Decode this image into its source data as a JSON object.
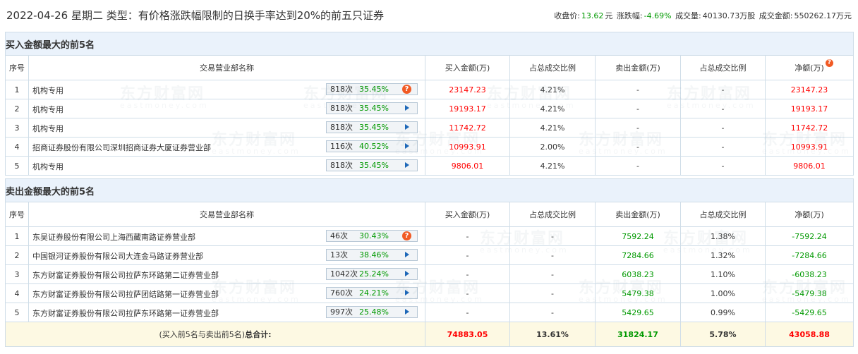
{
  "header": {
    "title": "2022-04-26 星期二 类型：有价格涨跌幅限制的日换手率达到20%的前五只证券",
    "close_label": "收盘价:",
    "close_value": "13.62",
    "close_unit": "元",
    "change_label": "涨跌幅:",
    "change_value": "-4.69%",
    "volume_label": "成交量:",
    "volume_value": "40130.73万股",
    "amount_label": "成交金额:",
    "amount_value": "550262.17万元"
  },
  "columns": {
    "index": "序号",
    "dept": "交易营业部名称",
    "buy": "买入金额(万)",
    "buy_pct": "占总成交比例",
    "sell": "卖出金额(万)",
    "sell_pct": "占总成交比例",
    "net": "净额(万)"
  },
  "buy_section": {
    "title": "买入金额最大的前5名",
    "rows": [
      {
        "idx": "1",
        "name": "机构专用",
        "times": "818次",
        "rate": "35.45%",
        "icon": "question-icon",
        "buy": "23147.23",
        "buy_pct": "4.21%",
        "sell": "-",
        "sell_pct": "-",
        "net": "23147.23"
      },
      {
        "idx": "2",
        "name": "机构专用",
        "times": "818次",
        "rate": "35.45%",
        "icon": "play-icon",
        "buy": "19193.17",
        "buy_pct": "4.21%",
        "sell": "-",
        "sell_pct": "-",
        "net": "19193.17"
      },
      {
        "idx": "3",
        "name": "机构专用",
        "times": "818次",
        "rate": "35.45%",
        "icon": "play-icon",
        "buy": "11742.72",
        "buy_pct": "4.21%",
        "sell": "-",
        "sell_pct": "-",
        "net": "11742.72"
      },
      {
        "idx": "4",
        "name": "招商证券股份有限公司深圳招商证券大厦证券营业部",
        "times": "116次",
        "rate": "40.52%",
        "icon": "play-icon",
        "buy": "10993.91",
        "buy_pct": "2.00%",
        "sell": "-",
        "sell_pct": "-",
        "net": "10993.91"
      },
      {
        "idx": "5",
        "name": "机构专用",
        "times": "818次",
        "rate": "35.45%",
        "icon": "play-icon",
        "buy": "9806.01",
        "buy_pct": "4.21%",
        "sell": "-",
        "sell_pct": "-",
        "net": "9806.01"
      }
    ]
  },
  "sell_section": {
    "title": "卖出金额最大的前5名",
    "rows": [
      {
        "idx": "1",
        "name": "东吴证券股份有限公司上海西藏南路证券营业部",
        "times": "46次",
        "rate": "30.43%",
        "icon": "question-icon",
        "buy": "-",
        "buy_pct": "-",
        "sell": "7592.24",
        "sell_pct": "1.38%",
        "net": "-7592.24"
      },
      {
        "idx": "2",
        "name": "中国银河证券股份有限公司大连金马路证券营业部",
        "times": "13次",
        "rate": "38.46%",
        "icon": "play-icon",
        "buy": "-",
        "buy_pct": "-",
        "sell": "7284.66",
        "sell_pct": "1.32%",
        "net": "-7284.66"
      },
      {
        "idx": "3",
        "name": "东方财富证券股份有限公司拉萨东环路第二证券营业部",
        "times": "1042次",
        "rate": "25.24%",
        "icon": "play-icon",
        "buy": "-",
        "buy_pct": "-",
        "sell": "6038.23",
        "sell_pct": "1.10%",
        "net": "-6038.23"
      },
      {
        "idx": "4",
        "name": "东方财富证券股份有限公司拉萨团结路第一证券营业部",
        "times": "760次",
        "rate": "24.21%",
        "icon": "play-icon",
        "buy": "-",
        "buy_pct": "-",
        "sell": "5479.38",
        "sell_pct": "1.00%",
        "net": "-5479.38"
      },
      {
        "idx": "5",
        "name": "东方财富证券股份有限公司拉萨东环路第一证券营业部",
        "times": "997次",
        "rate": "25.48%",
        "icon": "play-icon",
        "buy": "-",
        "buy_pct": "-",
        "sell": "5429.65",
        "sell_pct": "0.99%",
        "net": "-5429.65"
      }
    ]
  },
  "total": {
    "label_prefix": "(买入前5名与卖出前5名)",
    "label_bold": "总合计:",
    "buy": "74883.05",
    "buy_pct": "13.61%",
    "sell": "31824.17",
    "sell_pct": "5.78%",
    "net": "43058.88"
  },
  "watermark": {
    "cn": "东方财富网",
    "en": "eastmoney.com"
  },
  "colors": {
    "up": "#ff0000",
    "down": "#009900",
    "section_bg": "#eaf2fb",
    "total_bg": "#fdf9e3",
    "border": "#cfdde8"
  }
}
